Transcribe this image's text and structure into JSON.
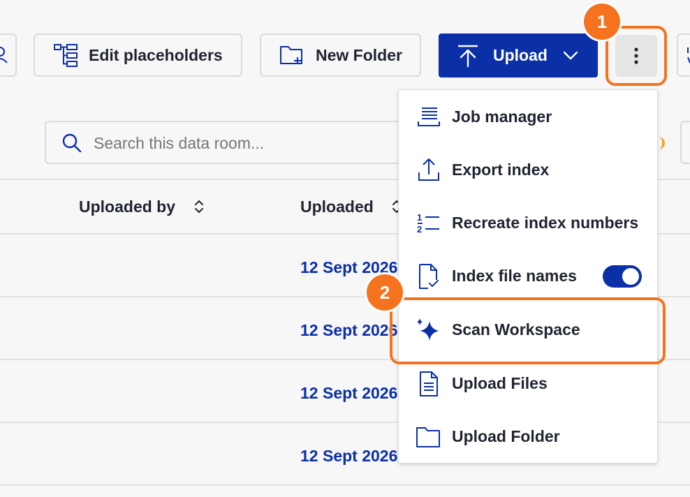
{
  "toolbar": {
    "edit_placeholders_label": "Edit placeholders",
    "new_folder_label": "New Folder",
    "upload_label": "Upload"
  },
  "search": {
    "placeholder": "Search this data room..."
  },
  "table": {
    "columns": [
      "Uploaded by",
      "Uploaded"
    ],
    "rows": [
      {
        "uploaded": "12 Sept 2026"
      },
      {
        "uploaded": "12 Sept 2026"
      },
      {
        "uploaded": "12 Sept 2026"
      },
      {
        "uploaded": "12 Sept 2026"
      }
    ]
  },
  "menu": {
    "items": [
      {
        "label": "Job manager",
        "icon": "job-manager-icon"
      },
      {
        "label": "Export index",
        "icon": "export-icon"
      },
      {
        "label": "Recreate index numbers",
        "icon": "numbered-list-icon"
      },
      {
        "label": "Index file names",
        "icon": "file-check-icon",
        "toggle": true
      },
      {
        "label": "Scan Workspace",
        "icon": "sparkle-icon"
      },
      {
        "label": "Upload Files",
        "icon": "file-icon"
      },
      {
        "label": "Upload Folder",
        "icon": "folder-icon"
      }
    ]
  },
  "annotations": {
    "step1": "1",
    "step2": "2"
  },
  "colors": {
    "primary": "#0a2fa6",
    "highlight": "#f5731f"
  }
}
